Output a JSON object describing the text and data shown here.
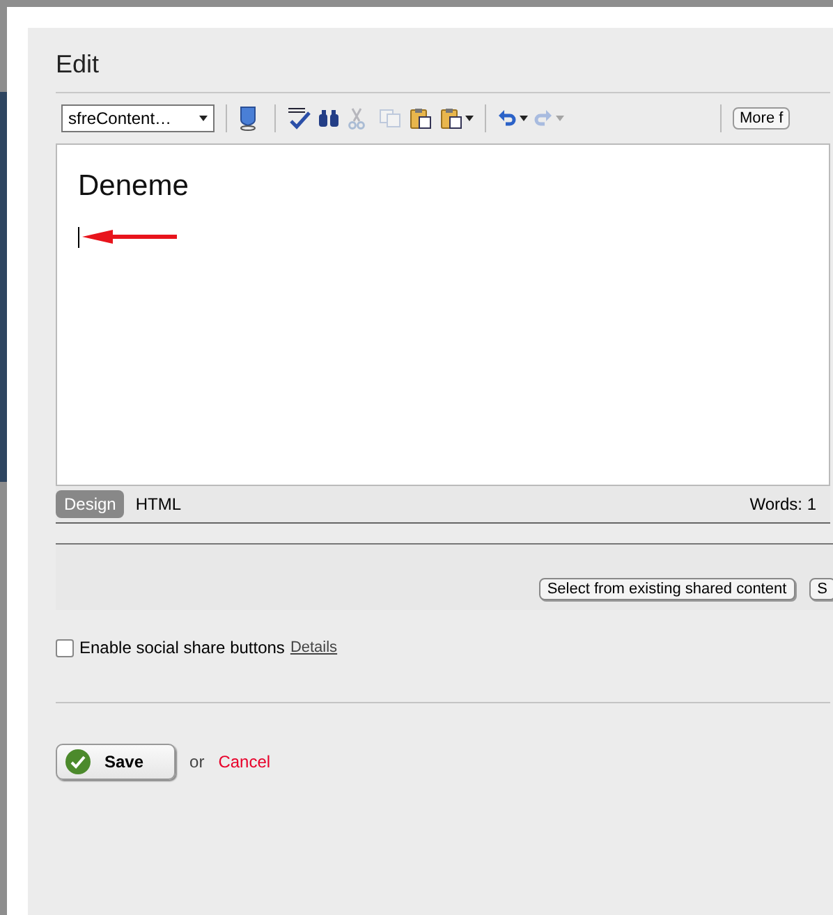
{
  "title": "Edit",
  "toolbar": {
    "style_select": "sfreContent…",
    "items": [
      {
        "kind": "separator"
      },
      {
        "kind": "icon",
        "disabled": false
      },
      {
        "kind": "separator"
      },
      {
        "kind": "icon",
        "disabled": false
      },
      {
        "kind": "icon",
        "disabled": false
      },
      {
        "kind": "icon",
        "disabled": true
      },
      {
        "kind": "icon",
        "disabled": true
      },
      {
        "kind": "icon",
        "disabled": false
      },
      {
        "kind": "menu",
        "disabled": false
      },
      {
        "kind": "separator"
      },
      {
        "kind": "menu",
        "disabled": false
      },
      {
        "kind": "menu",
        "disabled": true
      },
      {
        "kind": "spacer"
      },
      {
        "kind": "separator"
      },
      {
        "kind": "button",
        "label": "More f"
      }
    ]
  },
  "editor": {
    "heading": "Deneme"
  },
  "mode_tabs": [
    {
      "label": "Design",
      "selected": true
    },
    {
      "label": "HTML",
      "selected": false
    }
  ],
  "word_count": "Words: 1",
  "shared_buttons": [
    "Select from existing shared content",
    "S"
  ],
  "social_share": {
    "label": "Enable social share buttons",
    "checked": false,
    "link": "Details"
  },
  "actions": {
    "save": "Save",
    "or": "or",
    "cancel": "Cancel"
  }
}
